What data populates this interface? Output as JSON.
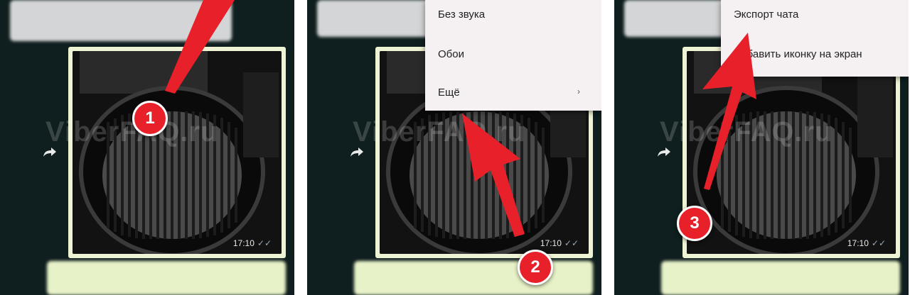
{
  "panels": [
    {
      "photo": {
        "time": "17:10",
        "ticks": "✓✓"
      },
      "watermark": "ViberFAQ.ru",
      "step": "1"
    },
    {
      "photo": {
        "time": "17:10",
        "ticks": "✓✓"
      },
      "watermark": "ViberFAQ.ru",
      "menu": {
        "items": [
          "Без звука",
          "Обои",
          "Ещё"
        ],
        "more_arrow": "›"
      },
      "step": "2"
    },
    {
      "photo": {
        "time": "17:10",
        "ticks": "✓✓"
      },
      "watermark": "ViberFAQ.ru",
      "menu": {
        "items": [
          "Экспорт чата",
          "Добавить иконку на экран"
        ]
      },
      "step": "3"
    }
  ],
  "colors": {
    "chat_bg": "#0f1e1e",
    "menu_bg": "#f5f1f3",
    "badge": "#e8202a",
    "arrow": "#e8202a",
    "photo_frame": "#eef3d3"
  },
  "icons": {
    "share": "share-arrow-icon"
  }
}
